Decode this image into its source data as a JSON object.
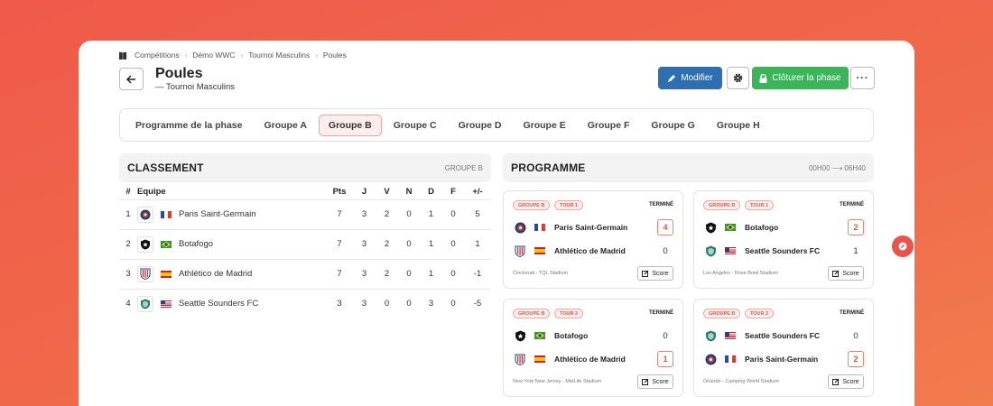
{
  "breadcrumb": [
    "Compétitions",
    "Démo WWC",
    "Tournoi Masculins",
    "Poules"
  ],
  "header": {
    "title": "Poules",
    "subtitle": "— Tournoi Masculins",
    "edit_label": "Modifier",
    "close_label": "Clôturer la phase",
    "more_label": "···"
  },
  "tabs": [
    "Programme de la phase",
    "Groupe A",
    "Groupe B",
    "Groupe C",
    "Groupe D",
    "Groupe E",
    "Groupe F",
    "Groupe G",
    "Groupe H"
  ],
  "active_tab": "Groupe B",
  "standings": {
    "title": "CLASSEMENT",
    "group_label": "GROUPE B",
    "columns": [
      "#",
      "Equipe",
      "Pts",
      "J",
      "V",
      "N",
      "D",
      "F",
      "+/-"
    ],
    "rows": [
      {
        "rank": "1",
        "team": "Paris Saint-Germain",
        "crest": "psg-crest-icon",
        "flag": "france-flag-icon",
        "pts": "7",
        "j": "3",
        "v": "2",
        "n": "0",
        "d": "1",
        "f": "0",
        "diff": "5"
      },
      {
        "rank": "2",
        "team": "Botafogo",
        "crest": "botafogo-crest-icon",
        "flag": "brazil-flag-icon",
        "pts": "7",
        "j": "3",
        "v": "2",
        "n": "0",
        "d": "1",
        "f": "0",
        "diff": "1"
      },
      {
        "rank": "3",
        "team": "Athlético de Madrid",
        "crest": "atletico-crest-icon",
        "flag": "spain-flag-icon",
        "pts": "7",
        "j": "3",
        "v": "2",
        "n": "0",
        "d": "1",
        "f": "0",
        "diff": "-1"
      },
      {
        "rank": "4",
        "team": "Seattle Sounders FC",
        "crest": "sounders-crest-icon",
        "flag": "usa-flag-icon",
        "pts": "3",
        "j": "3",
        "v": "0",
        "n": "0",
        "d": "3",
        "f": "0",
        "diff": "-5"
      }
    ]
  },
  "programme": {
    "title": "PROGRAMME",
    "time_range": "00H00 ⟶ 06H40",
    "score_label": "Score",
    "matches": [
      {
        "group": "GROUPE B",
        "round": "TOUR 1",
        "status": "TERMINÉ",
        "home": {
          "name": "Paris Saint-Germain",
          "score": "4",
          "winner": true
        },
        "away": {
          "name": "Athlético de Madrid",
          "score": "0",
          "winner": false
        },
        "venue": "Cincinnati - TQL Stadium"
      },
      {
        "group": "GROUPE B",
        "round": "TOUR 1",
        "status": "TERMINÉ",
        "home": {
          "name": "Botafogo",
          "score": "2",
          "winner": true
        },
        "away": {
          "name": "Seattle Sounders FC",
          "score": "1",
          "winner": false
        },
        "venue": "Los Angeles - Rose Bowl Stadium"
      },
      {
        "group": "GROUPE B",
        "round": "TOUR 2",
        "status": "TERMINÉ",
        "home": {
          "name": "Botafogo",
          "score": "0",
          "winner": false
        },
        "away": {
          "name": "Athlético de Madrid",
          "score": "1",
          "winner": true
        },
        "venue": "New York New Jersey - MetLife Stadium"
      },
      {
        "group": "GROUPE B",
        "round": "TOUR 2",
        "status": "TERMINÉ",
        "home": {
          "name": "Seattle Sounders FC",
          "score": "0",
          "winner": false
        },
        "away": {
          "name": "Paris Saint-Germain",
          "score": "2",
          "winner": true
        },
        "venue": "Orlando - Camping World Stadium"
      }
    ]
  },
  "colors": {
    "accent": "#e9534a",
    "primary": "#2d6fb0",
    "success": "#3bb55a"
  }
}
